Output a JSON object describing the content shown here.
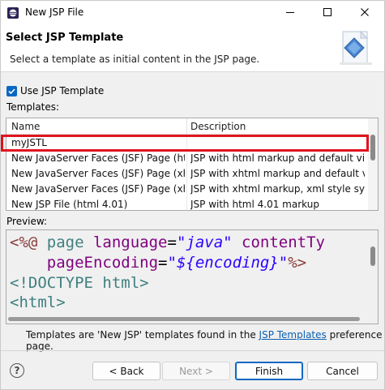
{
  "window": {
    "title": "New JSP File",
    "icons": {
      "app": "eclipse-icon",
      "minimize": "minimize-icon",
      "maximize": "maximize-icon",
      "close": "close-icon"
    }
  },
  "header": {
    "title": "Select JSP Template",
    "description": "Select a template as initial content in the JSP page.",
    "graphic": "jsp-wizard-graphic"
  },
  "use_template": {
    "label": "Use JSP Template",
    "checked": true
  },
  "templates": {
    "label": "Templates:",
    "columns": [
      "Name",
      "Description"
    ],
    "rows": [
      {
        "name": "myJSTL",
        "description": ""
      },
      {
        "name": "New JavaServer Faces (JSF) Page (html)",
        "description": "JSP with html markup and default vi..."
      },
      {
        "name": "New JavaServer Faces (JSF) Page (xht...",
        "description": "JSP with xhtml markup and default v..."
      },
      {
        "name": "New JavaServer Faces (JSF) Page (xht...",
        "description": "JSP with xhtml markup, xml style syn..."
      },
      {
        "name": "New JSP File (html 4.01)",
        "description": "JSP with html 4.01 markup"
      }
    ],
    "selected_index": 0
  },
  "preview": {
    "label": "Preview:",
    "lines": [
      [
        "<%@",
        " page ",
        "language",
        "=",
        "\"java\"",
        " contentTy"
      ],
      [
        "    ",
        "pageEncoding",
        "=",
        "\"${encoding}\"",
        "%>"
      ],
      [
        "<!DOCTYPE html>"
      ],
      [
        "<html>"
      ]
    ]
  },
  "footer": {
    "note_before": "Templates are 'New JSP' templates found in the ",
    "link": "JSP Templates",
    "note_after": " preference page."
  },
  "buttons": {
    "help": "?",
    "back": "< Back",
    "next": "Next >",
    "finish": "Finish",
    "cancel": "Cancel"
  },
  "colors": {
    "accent": "#0a67c2",
    "highlight": "#e0141e",
    "link": "#0b5fb3"
  }
}
